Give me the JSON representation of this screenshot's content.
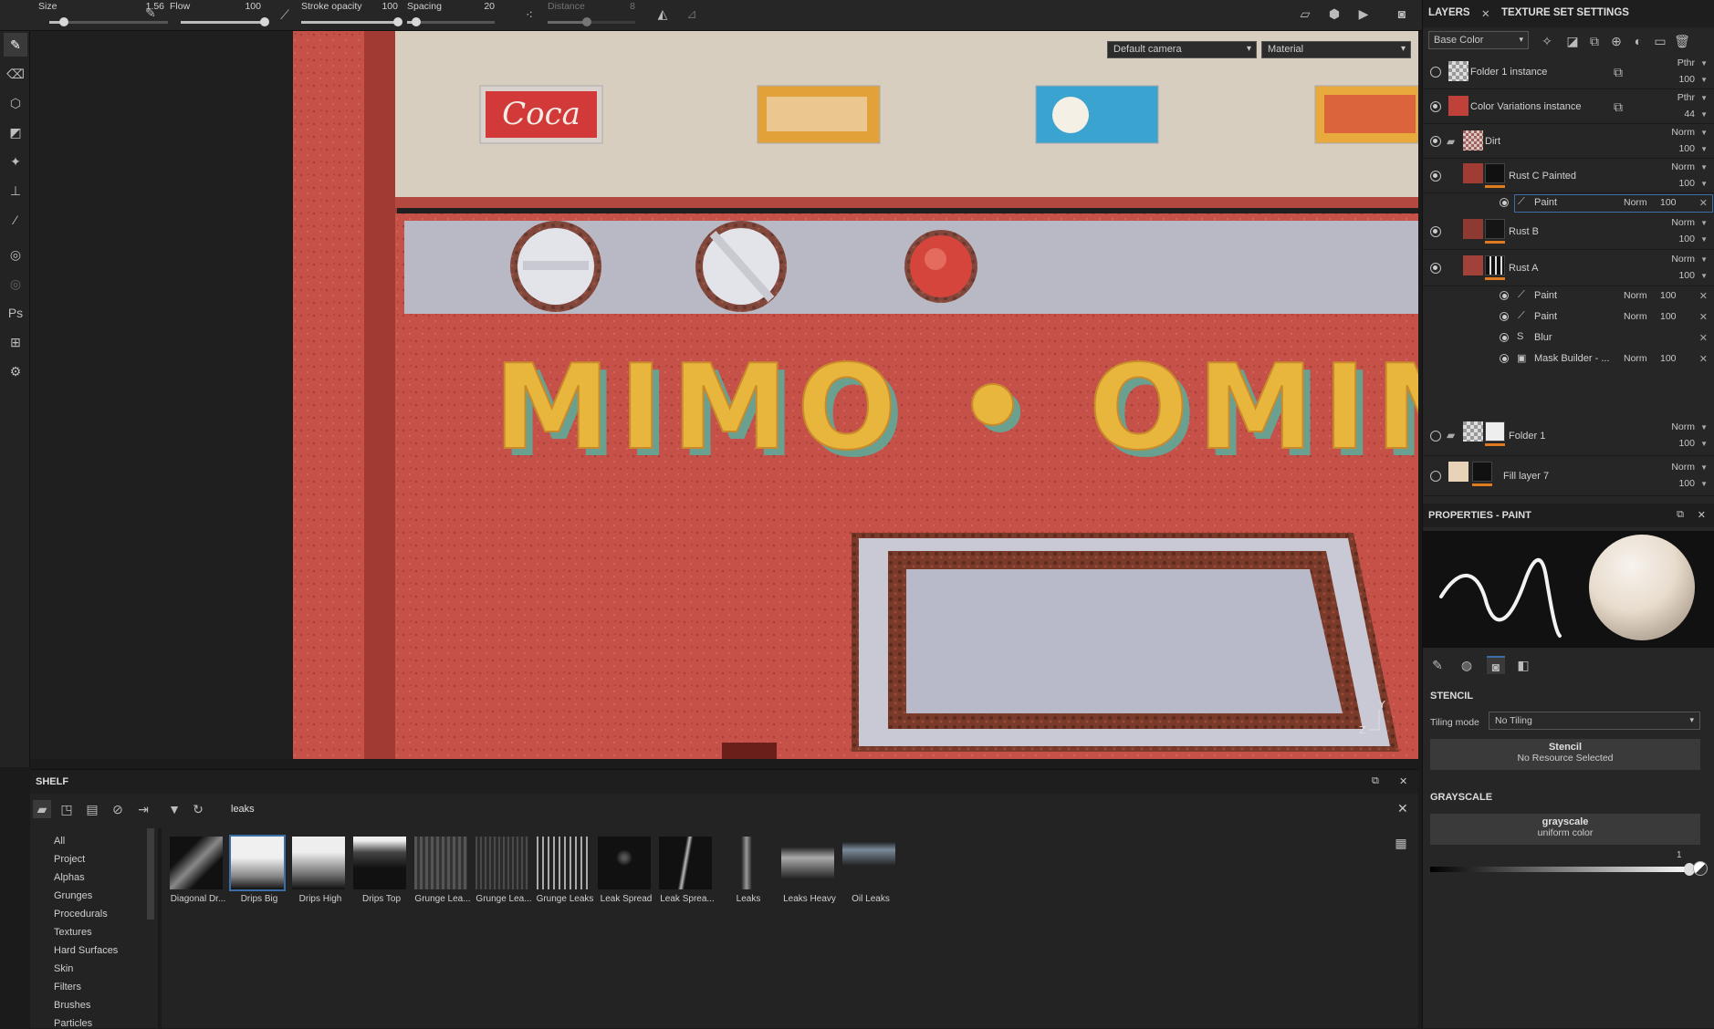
{
  "topbar": {
    "size_label": "Size",
    "size_value": "1.56",
    "size_level": 0.12,
    "flow_label": "Flow",
    "flow_value": "100",
    "flow_level": 1.0,
    "stroke_opacity_label": "Stroke opacity",
    "stroke_opacity_value": "100",
    "stroke_opacity_level": 1.0,
    "spacing_label": "Spacing",
    "spacing_value": "20",
    "spacing_level": 0.1,
    "distance_label": "Distance",
    "distance_value": "8",
    "distance_level": 0.45
  },
  "viewport": {
    "camera_select": "Default camera",
    "mode_select": "Material",
    "axis_y": "Y",
    "axis_z": "Z",
    "sign_text": "MIMO • OMIM",
    "sticker_1": "Coca"
  },
  "layers_panel": {
    "tab_layers": "LAYERS",
    "tab_texture_set": "TEXTURE SET SETTINGS",
    "channel_select": "Base Color",
    "layers": [
      {
        "name": "Folder 1 instance",
        "blend": "Pthr",
        "opacity": "100",
        "visible": false
      },
      {
        "name": "Color Variations  instance",
        "blend": "Pthr",
        "opacity": "44",
        "visible": true
      },
      {
        "name": "Dirt",
        "blend": "Norm",
        "opacity": "100",
        "visible": true
      },
      {
        "name": "Rust C Painted",
        "blend": "Norm",
        "opacity": "100",
        "visible": true
      },
      {
        "name": "Rust B",
        "blend": "Norm",
        "opacity": "100",
        "visible": true
      },
      {
        "name": "Rust A",
        "blend": "Norm",
        "opacity": "100",
        "visible": true
      },
      {
        "name": "Folder 1",
        "blend": "Norm",
        "opacity": "100",
        "visible": false
      },
      {
        "name": "Fill layer 7",
        "blend": "Norm",
        "opacity": "100",
        "visible": false
      }
    ],
    "sub_paint_c": {
      "name": "Paint",
      "blend": "Norm",
      "opacity": "100"
    },
    "sub_rust_a": [
      {
        "name": "Paint",
        "blend": "Norm",
        "opacity": "100"
      },
      {
        "name": "Paint",
        "blend": "Norm",
        "opacity": "100"
      },
      {
        "name": "Blur",
        "blend": "",
        "opacity": ""
      },
      {
        "name": "Mask Builder - ...",
        "blend": "Norm",
        "opacity": "100"
      }
    ]
  },
  "properties": {
    "title": "PROPERTIES - PAINT",
    "stencil_header": "STENCIL",
    "tiling_label": "Tiling mode",
    "tiling_value": "No Tiling",
    "stencil_btn": "Stencil",
    "stencil_sub": "No Resource Selected",
    "grayscale_header": "GRAYSCALE",
    "grayscale_btn": "grayscale",
    "grayscale_sub": "uniform color",
    "grayscale_value": "1"
  },
  "shelf": {
    "title": "SHELF",
    "search_value": "leaks",
    "categories": [
      "All",
      "Project",
      "Alphas",
      "Grunges",
      "Procedurals",
      "Textures",
      "Hard Surfaces",
      "Skin",
      "Filters",
      "Brushes",
      "Particles"
    ],
    "items": [
      "Diagonal Dr...",
      "Drips Big",
      "Drips High",
      "Drips Top",
      "Grunge Lea...",
      "Grunge Lea...",
      "Grunge Leaks",
      "Leak Spread",
      "Leak Sprea...",
      "Leaks",
      "Leaks Heavy",
      "Oil Leaks"
    ],
    "selected_item": "Drips Big"
  },
  "colors": {
    "accent_blue": "#3a6ea5",
    "orange": "#e07a1f",
    "panel_bg": "#262626"
  }
}
